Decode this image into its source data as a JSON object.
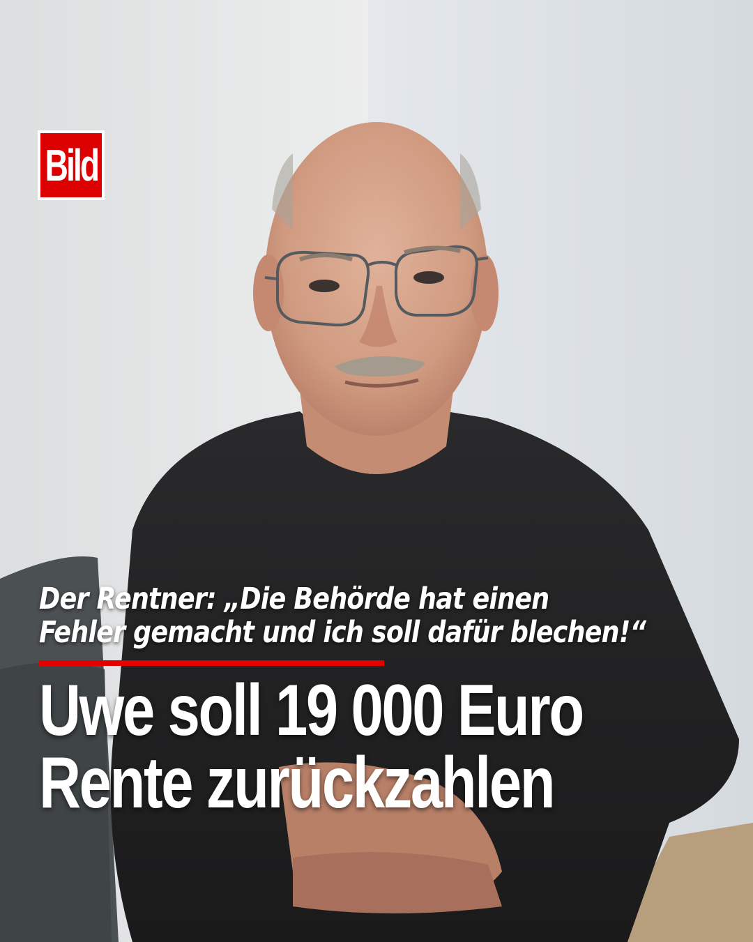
{
  "brand": {
    "logo_text": "Bild",
    "logo_red": "#dd0000",
    "accent_red": "#e50000"
  },
  "kicker": {
    "line1": "Der Rentner: „Die Behörde hat einen",
    "line2": "Fehler gemacht und ich soll dafür blechen!“"
  },
  "headline": {
    "line1": "Uwe soll 19 000 Euro",
    "line2": "Rente zurückzahlen"
  }
}
